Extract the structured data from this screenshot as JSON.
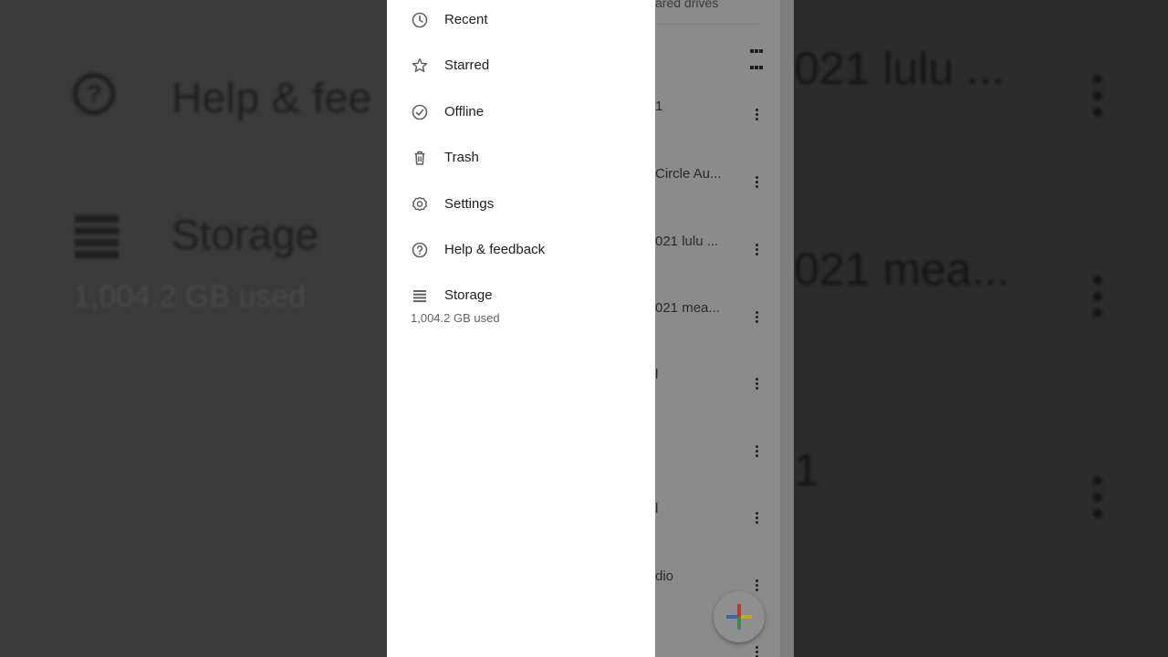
{
  "background_zoom": {
    "help_text": "Help & fee",
    "storage_text": "Storage",
    "storage_used": "1,004.2 GB used",
    "right_items": [
      "021 lulu ...",
      "021 mea...",
      "1"
    ]
  },
  "file_list": {
    "header_partial": "ared drives",
    "items": [
      {
        "label": "1"
      },
      {
        "label": "Circle Au..."
      },
      {
        "label": "021 lulu ..."
      },
      {
        "label": "021 mea..."
      },
      {
        "label": "l"
      },
      {
        "label": ""
      },
      {
        "label": "l"
      },
      {
        "label": "dio"
      },
      {
        "label": ""
      }
    ]
  },
  "drawer": {
    "items": [
      {
        "label": "Recent",
        "icon": "clock-icon"
      },
      {
        "label": "Starred",
        "icon": "star-icon"
      },
      {
        "label": "Offline",
        "icon": "offline-icon"
      },
      {
        "label": "Trash",
        "icon": "trash-icon"
      },
      {
        "label": "Settings",
        "icon": "gear-icon"
      },
      {
        "label": "Help & feedback",
        "icon": "help-icon"
      },
      {
        "label": "Storage",
        "icon": "storage-icon"
      }
    ],
    "storage_used": "1,004.2 GB used"
  },
  "colors": {
    "drawer_bg": "#ffffff",
    "scrim": "#8b8b8b",
    "text_primary": "#202124",
    "text_secondary": "#5f6368"
  }
}
